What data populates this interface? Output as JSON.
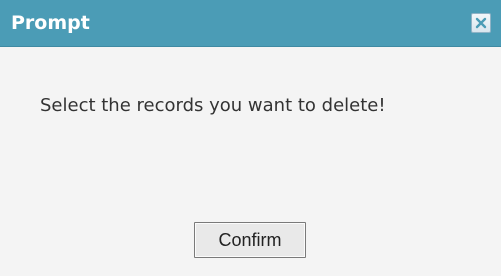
{
  "dialog": {
    "title": "Prompt",
    "message": "Select the records you want to delete!",
    "confirm_label": "Confirm",
    "close_icon": "close-icon"
  },
  "colors": {
    "titlebar": "#4b9cb6",
    "title_text": "#ffffff",
    "body_background": "#f4f4f4",
    "message_text": "#333333",
    "button_background": "#e9e9e9",
    "button_border": "#7a7a7a",
    "close_icon": "#4b9cb6"
  }
}
